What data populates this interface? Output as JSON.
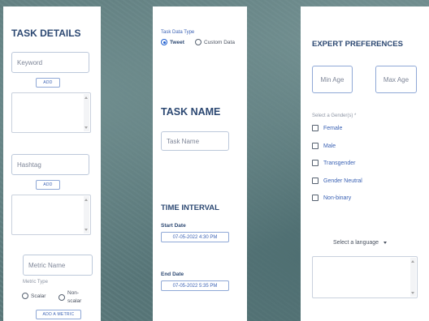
{
  "task_details": {
    "title": "TASK DETAILS",
    "keyword_placeholder": "Keyword",
    "add_keyword_label": "ADD",
    "hashtag_placeholder": "Hashtag",
    "add_hashtag_label": "ADD",
    "metric_name_placeholder": "Metric Name",
    "metric_type_label": "Metric Type",
    "metric_type_options": [
      "Scalar",
      "Non-scalar"
    ],
    "add_metric_label": "ADD A METRIC"
  },
  "task_data": {
    "data_type_label": "Task Data Type",
    "data_type_options": [
      "Tweet",
      "Custom Data"
    ],
    "selected_data_type": "Tweet",
    "task_name_title": "TASK NAME",
    "task_name_placeholder": "Task Name",
    "time_interval_title": "TIME INTERVAL",
    "start_date_label": "Start Date",
    "start_date_value": "07-05-2022 4:30 PM",
    "end_date_label": "End Date",
    "end_date_value": "07-05-2022 5:35 PM"
  },
  "expert_preferences": {
    "title": "EXPERT PREFERENCES",
    "min_age_placeholder": "Min Age",
    "max_age_placeholder": "Max Age",
    "gender_label": "Select a Gender(s) *",
    "genders": [
      "Female",
      "Male",
      "Transgender",
      "Gender Neutral",
      "Non-binary"
    ],
    "language_label": "Select a language"
  }
}
